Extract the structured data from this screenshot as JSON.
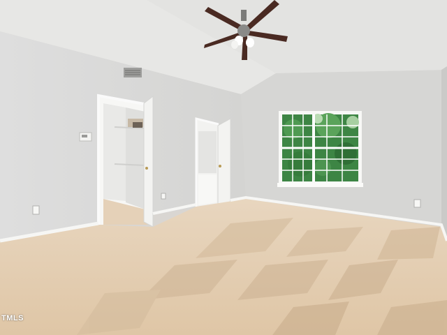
{
  "watermark": {
    "text": "TMLS"
  },
  "colors": {
    "ceiling": "#e6e6e4",
    "wall_left": "#dcdcda",
    "wall_back": "#d8d8d6",
    "wall_right": "#cfcfcd",
    "carpet": "#e6d3bc",
    "carpet_shadow": "#cdb597",
    "baseboard": "#f5f5f3",
    "window_glass": "#3f8a45",
    "window_frame": "#ffffff",
    "fan_blade": "#4a2a22",
    "door": "#f3f3f1"
  },
  "icons": [
    "ceiling-fan-icon",
    "air-vent-icon",
    "thermostat-icon",
    "outlet-icon"
  ]
}
